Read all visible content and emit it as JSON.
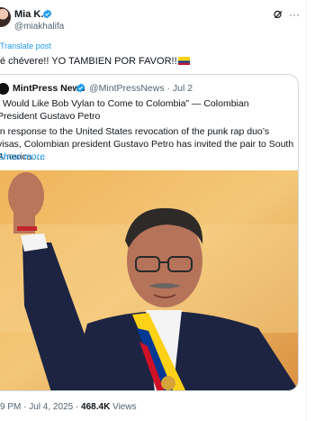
{
  "author": {
    "name": "Mia K.",
    "handle": "@miakhalifa"
  },
  "translate_label": "Translate post",
  "tweet_text": "é chévere!! YO TAMBIEN POR FAVOR!!",
  "quote": {
    "name": "MintPress News",
    "handle_date": "@MintPressNews · Jul 2",
    "headline": "I Would Like Bob Vylan to Come to Colombia” — Colombian President Gustavo Petro",
    "body": "In response to the United States revocation of the punk rap duo’s visas, Colombian president Gustavo Petro has invited the pair to South America. ...",
    "show_more": "Show more"
  },
  "meta": {
    "time_date": "9 PM · Jul 4, 2025 · ",
    "views_count": "468.4K",
    "views_label": " Views"
  },
  "icons": [
    "verified-badge-icon",
    "grok-icon",
    "more-options-icon",
    "colombia-flag-icon"
  ],
  "colors": {
    "link": "#1d9bf0",
    "verified": "#1d9bf0",
    "border": "#cfd9de",
    "muted": "#536471"
  }
}
